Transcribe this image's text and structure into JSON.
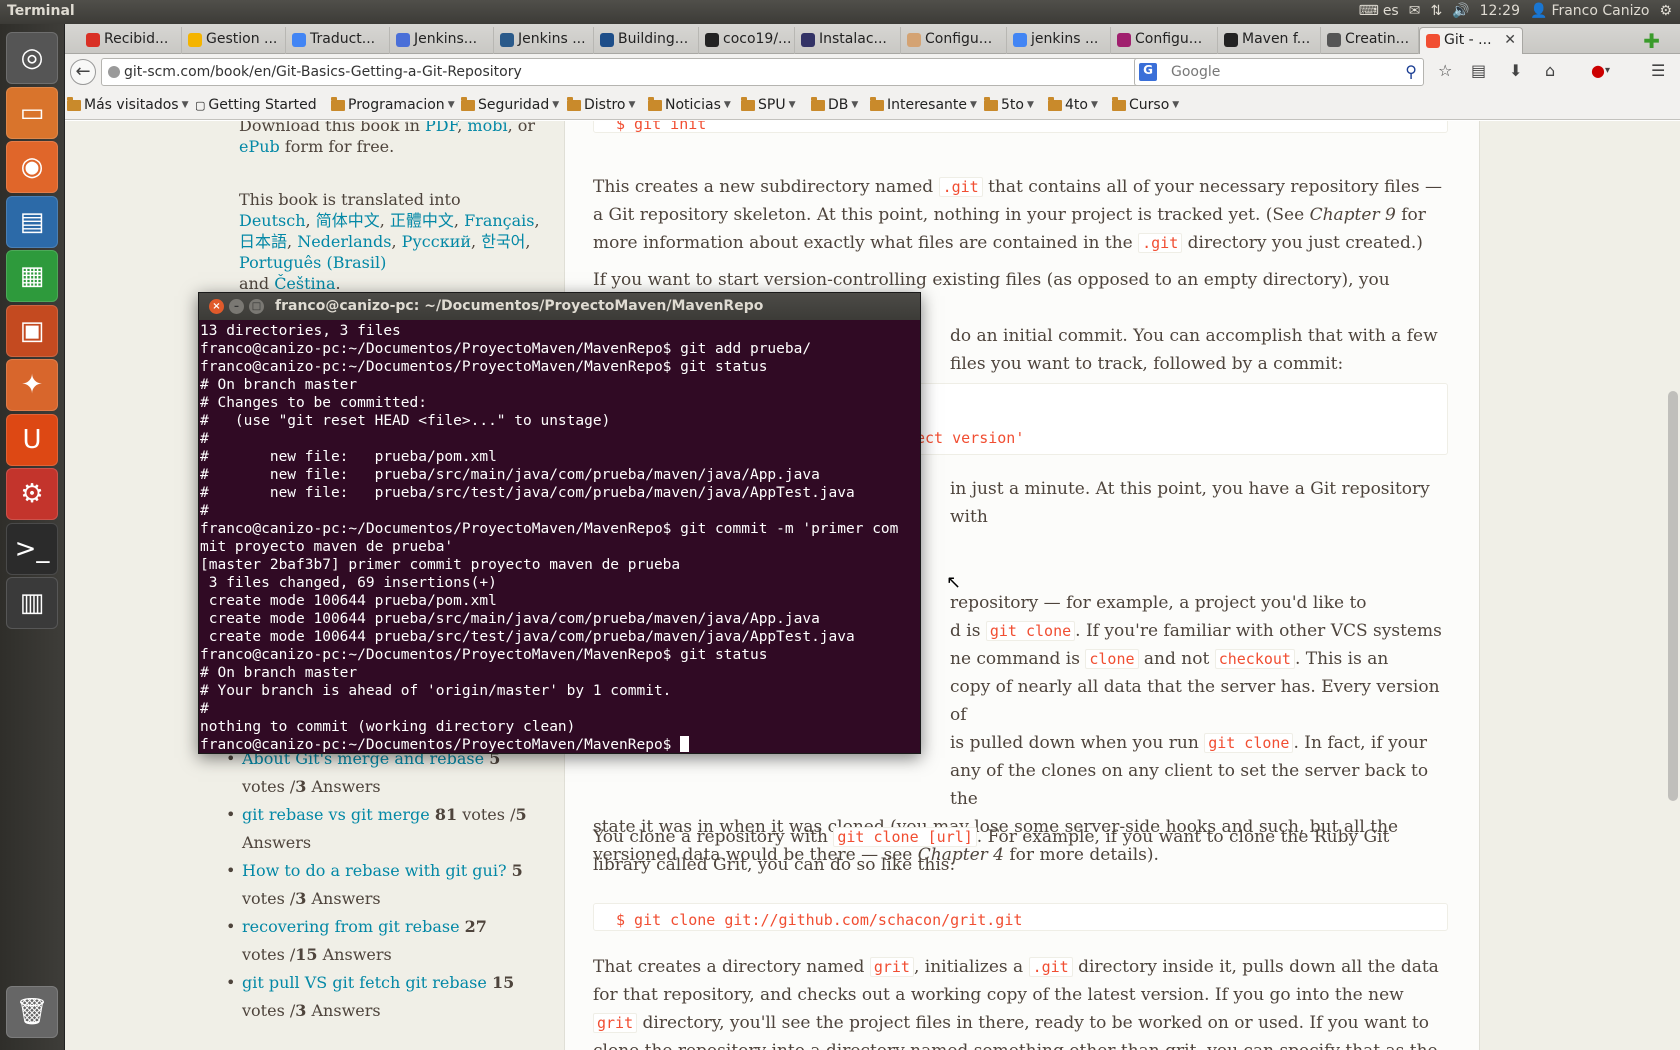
{
  "top_panel": {
    "app_title": "Terminal",
    "keyboard_layout": "es",
    "clock": "12:29",
    "user_name": "Franco Canizo"
  },
  "launcher": {
    "items": [
      {
        "name": "dash-home-icon",
        "color": "#555"
      },
      {
        "name": "files-icon",
        "color": "#d9742c"
      },
      {
        "name": "firefox-icon",
        "color": "#e0662a"
      },
      {
        "name": "writer-icon",
        "color": "#2c6aa8"
      },
      {
        "name": "calc-icon",
        "color": "#2e9a3c"
      },
      {
        "name": "impress-icon",
        "color": "#c44a20"
      },
      {
        "name": "software-center-icon",
        "color": "#d8662c"
      },
      {
        "name": "ubuntu-one-icon",
        "color": "#dd4814"
      },
      {
        "name": "system-settings-icon",
        "color": "#c3342c"
      },
      {
        "name": "terminal-icon",
        "color": "#2b2b2b"
      },
      {
        "name": "workspace-switcher-icon",
        "color": "#3a3a3a"
      },
      {
        "name": "trash-icon",
        "color": "#666"
      }
    ]
  },
  "tabs": [
    {
      "label": "Recibid...",
      "color": "#d93025"
    },
    {
      "label": "Gestion ...",
      "color": "#f4b400"
    },
    {
      "label": "Traduct...",
      "color": "#4285f4"
    },
    {
      "label": "Jenkins...",
      "color": "#4a6fd8"
    },
    {
      "label": "Jenkins ...",
      "color": "#2a5a8a"
    },
    {
      "label": "Building...",
      "color": "#1d4e89"
    },
    {
      "label": "coco19/...",
      "color": "#222"
    },
    {
      "label": "Instalac...",
      "color": "#333366"
    },
    {
      "label": "Configu...",
      "color": "#d4a373"
    },
    {
      "label": "jenkins ...",
      "color": "#4285f4"
    },
    {
      "label": "Configu...",
      "color": "#a0206e"
    },
    {
      "label": "Maven f...",
      "color": "#222"
    },
    {
      "label": "Creatin...",
      "color": "#555"
    },
    {
      "label": "Git - ...",
      "color": "#f14e32"
    }
  ],
  "nav": {
    "url": "git-scm.com/book/en/Git-Basics-Getting-a-Git-Repository",
    "search_placeholder": "Google"
  },
  "bookmarks": [
    {
      "label": "Más visitados",
      "folder": false,
      "dropdown": true
    },
    {
      "label": "Getting Started",
      "folder": false,
      "dropdown": false
    },
    {
      "label": "Programacion",
      "folder": true,
      "dropdown": true
    },
    {
      "label": "Seguridad",
      "folder": true,
      "dropdown": true
    },
    {
      "label": "Distro",
      "folder": true,
      "dropdown": true
    },
    {
      "label": "Noticias",
      "folder": true,
      "dropdown": true
    },
    {
      "label": "SPU",
      "folder": true,
      "dropdown": true
    },
    {
      "label": "DB",
      "folder": true,
      "dropdown": true
    },
    {
      "label": "Interesante",
      "folder": true,
      "dropdown": true
    },
    {
      "label": "5to",
      "folder": true,
      "dropdown": true
    },
    {
      "label": "4to",
      "folder": true,
      "dropdown": true
    },
    {
      "label": "Curso",
      "folder": true,
      "dropdown": true
    }
  ],
  "sidebar": {
    "download_text_1": "Download this book in",
    "pdf": "PDF",
    "mobi": "mobi",
    "or": ", or",
    "epub": "ePub",
    "download_text_2": "form for free.",
    "translated_intro": "This book is translated into",
    "languages": [
      "Deutsch",
      "简体中文",
      "正體中文",
      "Français",
      "日本語",
      "Nederlands",
      "Русский",
      "한국어",
      "Português (Brasil)",
      "Čeština"
    ],
    "and": "and",
    "related": [
      {
        "title": "About Git's merge and rebase",
        "votes": "5",
        "votes_label": "votes /",
        "answers": "3",
        "answers_label": "Answers"
      },
      {
        "title": "git rebase vs git merge",
        "votes": "81",
        "votes_label": "votes /",
        "answers": "5",
        "answers_label": "Answers"
      },
      {
        "title": "How to do a rebase with git gui?",
        "votes": "5",
        "votes_label": "votes /",
        "answers": "3",
        "answers_label": "Answers"
      },
      {
        "title": "recovering from git rebase",
        "votes": "27",
        "votes_label": "votes /",
        "answers": "15",
        "answers_label": "Answers"
      },
      {
        "title": "git pull VS git fetch git rebase",
        "votes": "15",
        "votes_label": "votes /",
        "answers": "3",
        "answers_label": "Answers"
      }
    ]
  },
  "content": {
    "top_code": "$ git init",
    "p1a": "This creates a new subdirectory named",
    "p1_code": ".git",
    "p1b": "that contains all of your necessary repository files — a Git repository skeleton. At this point, nothing in your project is tracked yet. (See",
    "p1_ch": "Chapter 9",
    "p1c": "for more information about exactly what files are contained in the",
    "p1_code2": ".git",
    "p1d": "directory you just created.)",
    "p2_line1": "If you want to start version-controlling existing files (as opposed to an empty directory), you should",
    "p2_line2": "do an initial commit. You can accomplish that with a few",
    "p2_line3": "files you want to track, followed by a commit:",
    "code2_tail": "ect version'",
    "p3_tail": "in just a minute. At this point, you have a Git repository with",
    "p4_line1_tail": "repository — for example, a project you'd like to",
    "p4_line2a": "d is",
    "p4_code1": "git clone",
    "p4_line2b": ". If you're familiar with other VCS systems",
    "p4_line3a": "ne command is",
    "p4_code2": "clone",
    "p4_line3b": "and not",
    "p4_code3": "checkout",
    "p4_line3c": ". This is an",
    "p4_line4": "copy of nearly all data that the server has. Every version of",
    "p4_line5a": "is pulled down when you run",
    "p4_code4": "git clone",
    "p4_line5b": ". In fact, if your",
    "p4_line6": "any of the clones on any client to set the server back to the",
    "p4_line7": "state it was in when it was cloned (you may lose some server-side hooks and such, but all the",
    "p4_line8a": "versioned data would be there — see",
    "p4_ch": "Chapter 4",
    "p4_line8b": "for more details).",
    "p5a": "You clone a repository with",
    "p5_code": "git clone [url]",
    "p5b": ". For example, if you want to clone the Ruby Git library called Grit, you can do so like this:",
    "code3": "$ git clone git://github.com/schacon/grit.git",
    "p6a": "That creates a directory named",
    "p6_code1": "grit",
    "p6b": ", initializes a",
    "p6_code2": ".git",
    "p6c": "directory inside it, pulls down all the data for that repository, and checks out a working copy of the latest version. If you go into the new",
    "p6_code3": "grit",
    "p6d": "directory, you'll see the project files in there, ready to be worked on or used. If you want to clone the repository into a directory named something other than grit, you can specify that as the next"
  },
  "terminal": {
    "title": "franco@canizo-pc: ~/Documentos/ProyectoMaven/MavenRepo",
    "lines": [
      "13 directories, 3 files",
      "franco@canizo-pc:~/Documentos/ProyectoMaven/MavenRepo$ git add prueba/",
      "franco@canizo-pc:~/Documentos/ProyectoMaven/MavenRepo$ git status",
      "# On branch master",
      "# Changes to be committed:",
      "#   (use \"git reset HEAD <file>...\" to unstage)",
      "#",
      "#       new file:   prueba/pom.xml",
      "#       new file:   prueba/src/main/java/com/prueba/maven/java/App.java",
      "#       new file:   prueba/src/test/java/com/prueba/maven/java/AppTest.java",
      "#",
      "franco@canizo-pc:~/Documentos/ProyectoMaven/MavenRepo$ git commit -m 'primer com",
      "mit proyecto maven de prueba'",
      "[master 2baf3b7] primer commit proyecto maven de prueba",
      " 3 files changed, 69 insertions(+)",
      " create mode 100644 prueba/pom.xml",
      " create mode 100644 prueba/src/main/java/com/prueba/maven/java/App.java",
      " create mode 100644 prueba/src/test/java/com/prueba/maven/java/AppTest.java",
      "franco@canizo-pc:~/Documentos/ProyectoMaven/MavenRepo$ git status",
      "# On branch master",
      "# Your branch is ahead of 'origin/master' by 1 commit.",
      "#",
      "nothing to commit (working directory clean)"
    ],
    "prompt": "franco@canizo-pc:~/Documentos/ProyectoMaven/MavenRepo$ "
  }
}
